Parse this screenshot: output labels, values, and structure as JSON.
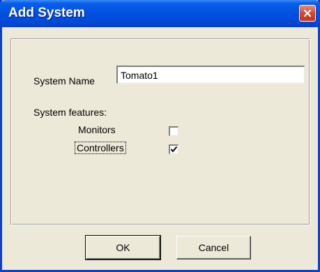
{
  "window": {
    "title": "Add System"
  },
  "form": {
    "system_name_label": "System Name",
    "system_name_value": "Tomato1",
    "features_label": "System features:",
    "features": [
      {
        "label": "Monitors",
        "checked": false
      },
      {
        "label": "Controllers",
        "checked": true
      }
    ]
  },
  "buttons": {
    "ok_label": "OK",
    "cancel_label": "Cancel"
  },
  "colors": {
    "titlebar": "#0050e0",
    "close_button": "#d5432a",
    "dialog_bg": "#ece9d8"
  },
  "icons": {
    "close": "close-icon",
    "check": "checkmark-icon"
  }
}
